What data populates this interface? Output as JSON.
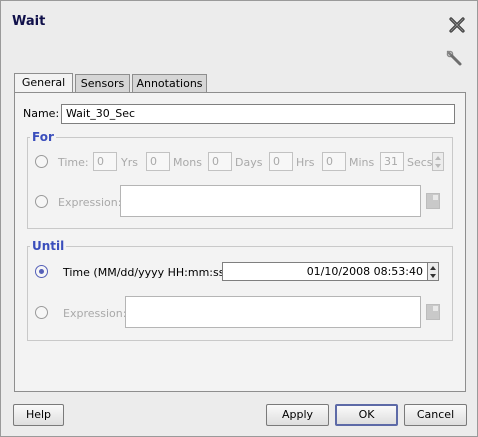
{
  "window": {
    "title": "Wait"
  },
  "tabs": [
    {
      "label": "General",
      "active": true
    },
    {
      "label": "Sensors",
      "active": false
    },
    {
      "label": "Annotations",
      "active": false
    }
  ],
  "general": {
    "name_label": "Name:",
    "name_value": "Wait_30_Sec"
  },
  "for_group": {
    "legend": "For",
    "time_label": "Time:",
    "fields": [
      {
        "value": "0",
        "unit": "Yrs"
      },
      {
        "value": "0",
        "unit": "Mons"
      },
      {
        "value": "0",
        "unit": "Days"
      },
      {
        "value": "0",
        "unit": "Hrs"
      },
      {
        "value": "0",
        "unit": "Mins"
      },
      {
        "value": "31",
        "unit": "Secs"
      }
    ],
    "expression_label": "Expression:",
    "expression_value": ""
  },
  "until_group": {
    "legend": "Until",
    "time_label": "Time (MM/dd/yyyy HH:mm:ss):",
    "time_value": "01/10/2008 08:53:40",
    "expression_label": "Expression:",
    "expression_value": ""
  },
  "buttons": {
    "help": "Help",
    "apply": "Apply",
    "ok": "OK",
    "cancel": "Cancel"
  },
  "icons": {
    "close": "close-icon",
    "wrench": "wrench-icon",
    "edit": "edit-expression-icon"
  },
  "colors": {
    "legend": "#3a4ebc",
    "title": "#10104a",
    "radio_selected": "#5560b8"
  }
}
